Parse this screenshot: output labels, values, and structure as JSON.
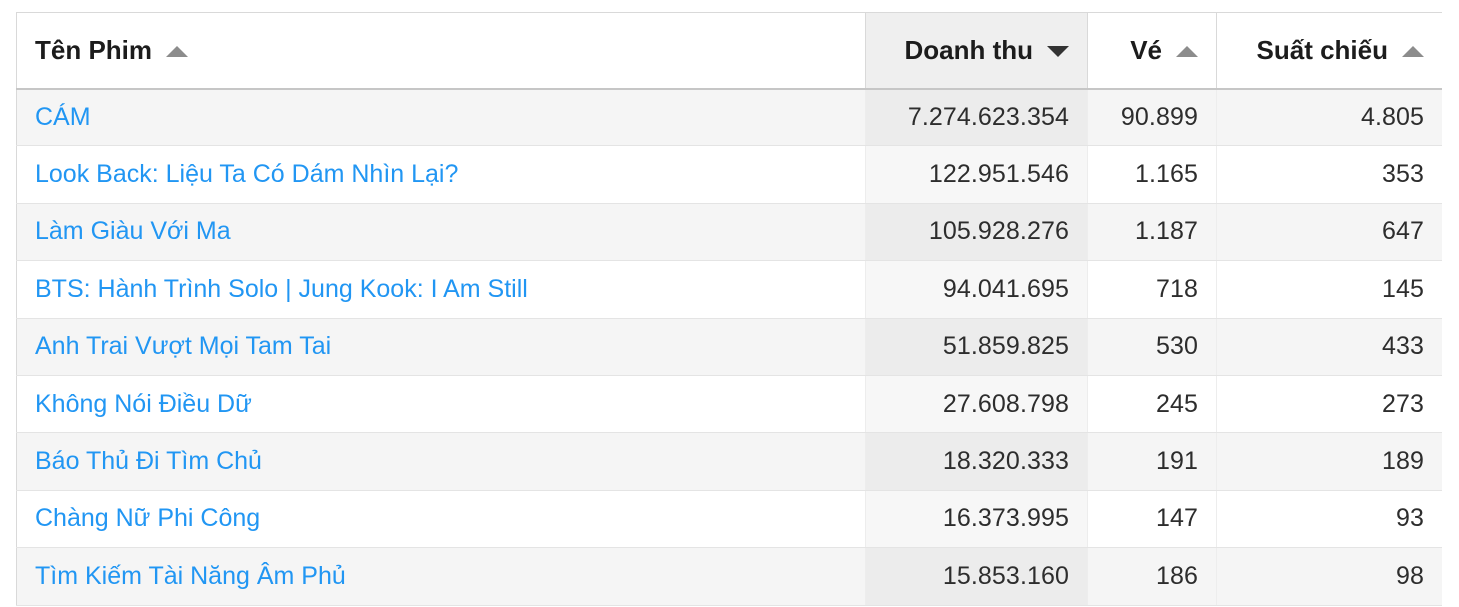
{
  "table": {
    "columns": [
      {
        "key": "name",
        "label": "Tên Phim",
        "align": "left",
        "sort": "asc",
        "active": false,
        "icon": "caret-up-icon"
      },
      {
        "key": "rev",
        "label": "Doanh thu",
        "align": "right",
        "sort": "desc",
        "active": true,
        "icon": "caret-down-icon"
      },
      {
        "key": "ticket",
        "label": "Vé",
        "align": "right",
        "sort": "asc",
        "active": false,
        "icon": "caret-up-icon"
      },
      {
        "key": "shows",
        "label": "Suất chiếu",
        "align": "right",
        "sort": "asc",
        "active": false,
        "icon": "caret-up-icon"
      }
    ],
    "rows": [
      {
        "name": "CÁM",
        "rev": "7.274.623.354",
        "ticket": "90.899",
        "shows": "4.805"
      },
      {
        "name": "Look Back: Liệu Ta Có Dám Nhìn Lại?",
        "rev": "122.951.546",
        "ticket": "1.165",
        "shows": "353"
      },
      {
        "name": "Làm Giàu Với Ma",
        "rev": "105.928.276",
        "ticket": "1.187",
        "shows": "647"
      },
      {
        "name": "BTS: Hành Trình Solo | Jung Kook: I Am Still",
        "rev": "94.041.695",
        "ticket": "718",
        "shows": "145"
      },
      {
        "name": "Anh Trai Vượt Mọi Tam Tai",
        "rev": "51.859.825",
        "ticket": "530",
        "shows": "433"
      },
      {
        "name": "Không Nói Điều Dữ",
        "rev": "27.608.798",
        "ticket": "245",
        "shows": "273"
      },
      {
        "name": "Báo Thủ Đi Tìm Chủ",
        "rev": "18.320.333",
        "ticket": "191",
        "shows": "189"
      },
      {
        "name": "Chàng Nữ Phi Công",
        "rev": "16.373.995",
        "ticket": "147",
        "shows": "93"
      },
      {
        "name": "Tìm Kiếm Tài Năng Âm Phủ",
        "rev": "15.853.160",
        "ticket": "186",
        "shows": "98"
      }
    ]
  },
  "colors": {
    "link": "#2196f3",
    "header_text": "#1c1c1c",
    "cell_text": "#2d2d2d",
    "sorted_header_bg": "#efefef",
    "row_odd_bg": "#f5f5f5",
    "row_even_bg": "#ffffff",
    "border": "#d9d9d9",
    "caret_active": "#333333",
    "caret_inactive": "#8c8c8c"
  }
}
